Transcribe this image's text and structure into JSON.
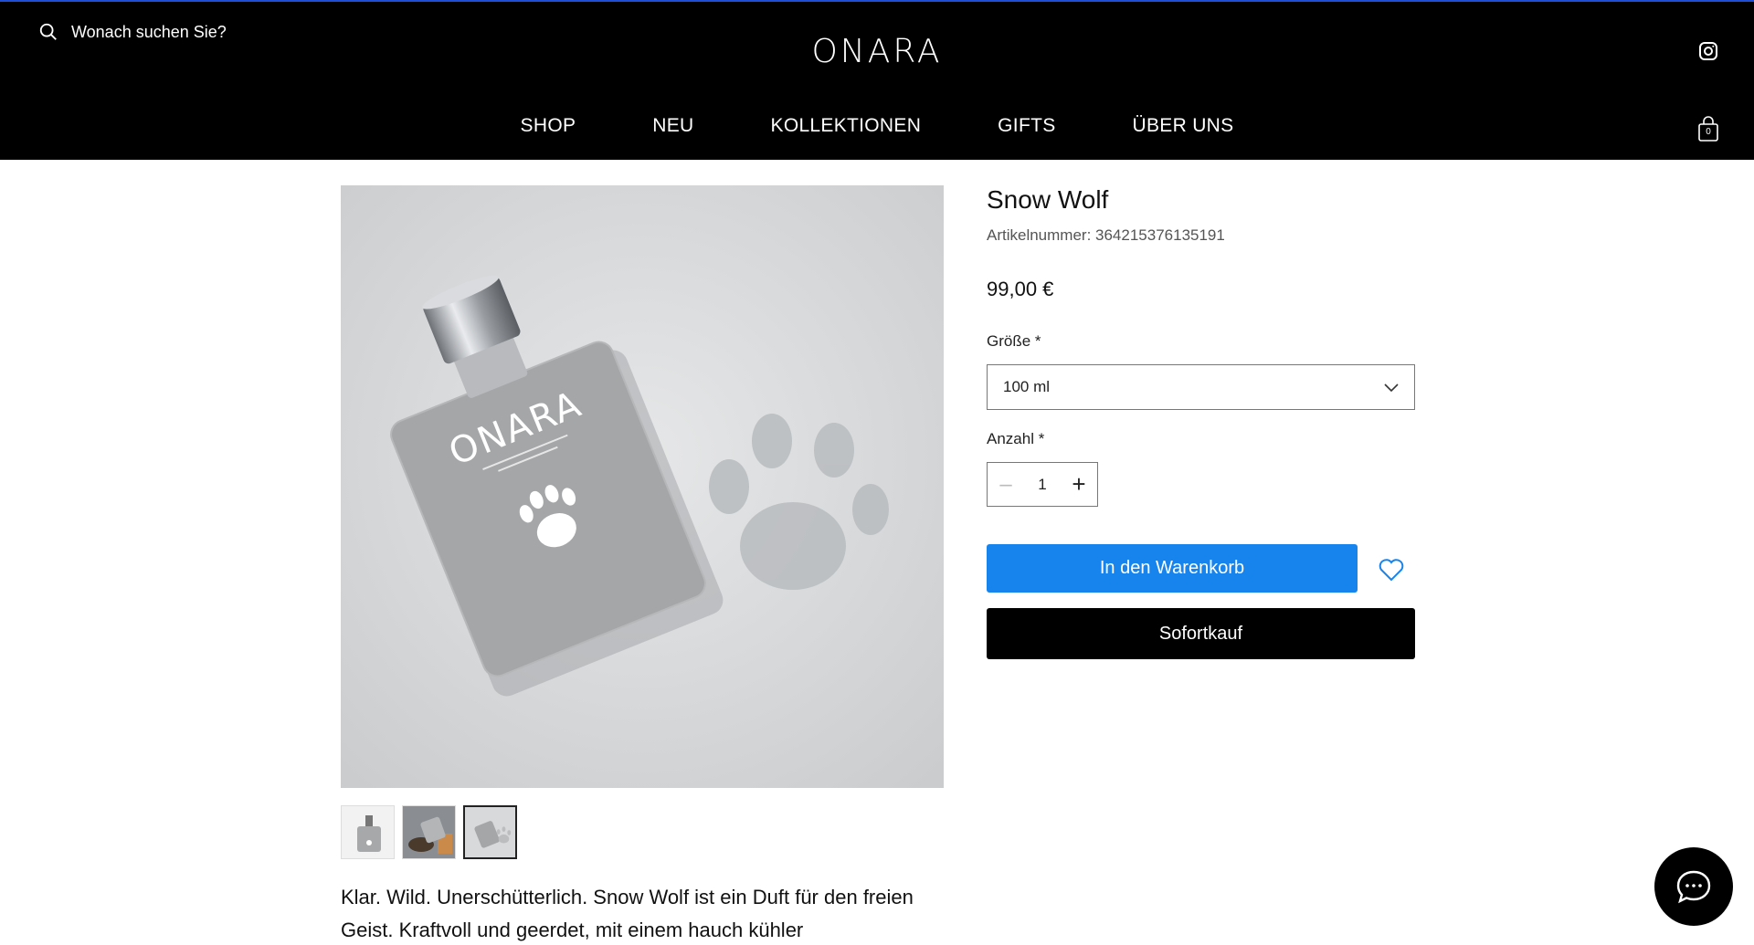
{
  "header": {
    "search_placeholder": "Wonach suchen Sie?",
    "logo": "ONARA",
    "nav": [
      "SHOP",
      "NEU",
      "KOLLEKTIONEN",
      "GIFTS",
      "ÜBER UNS"
    ],
    "cart_count": "0",
    "icons": [
      "search-icon",
      "instagram-icon",
      "cart-icon"
    ]
  },
  "product": {
    "title": "Snow Wolf",
    "sku": "Artikelnummer: 364215376135191",
    "price": "99,00 €",
    "size_label": "Größe *",
    "size_value": "100 ml",
    "quantity_label": "Anzahl *",
    "quantity": "1",
    "add_to_cart": "In den Warenkorb",
    "buy_now": "Sofortkauf",
    "bottle_logo": "ONARA",
    "description": "Klar. Wild. Unerschütterlich. Snow Wolf ist ein Duft für den freien Geist. Kraftvoll und geerdet, mit einem hauch kühler"
  },
  "gallery": {
    "thumbnail_count": 3,
    "active_thumbnail": 3
  },
  "colors": {
    "header_bg": "#000000",
    "accent_blue": "#1784ee",
    "buy_button": "#000000"
  }
}
